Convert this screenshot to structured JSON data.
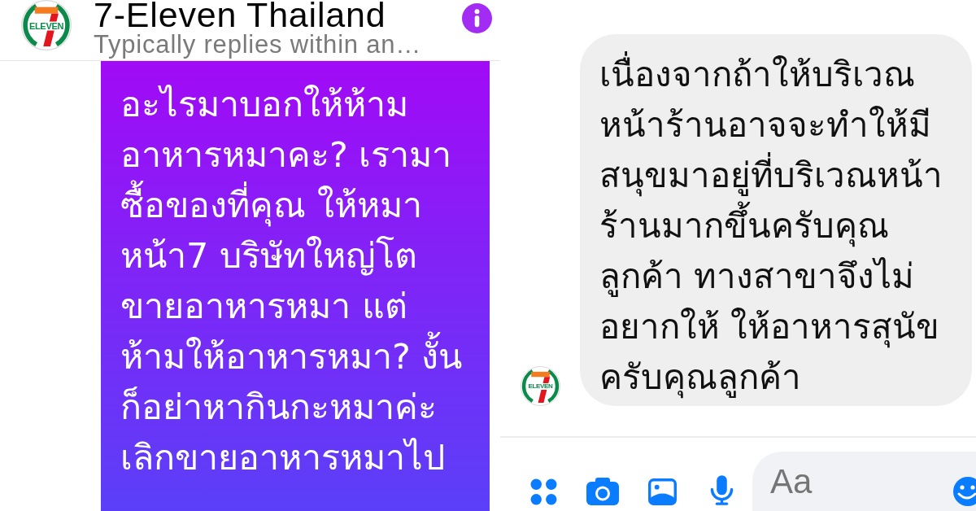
{
  "left_screenshot": {
    "header": {
      "avatar": {
        "logo_text": "ELEVEN"
      },
      "title": "7-Eleven Thailand",
      "subtitle": "Typically replies within an…"
    },
    "message": {
      "kind": "sent",
      "lines": [
        "อะไรมาบอกให้ห้าม",
        "อาหารหมาคะ? เรามา",
        "ซื้อของที่คุณ ให้หมา",
        "หน้า7 บริษัทใหญ่โต",
        "ขายอาหารหมา แต่",
        "ห้ามให้อาหารหมา? งั้น",
        "ก็อย่าหากินกะหมาค่ะ",
        "เลิกขายอาหารหมาไป"
      ]
    }
  },
  "right_screenshot": {
    "message": {
      "kind": "received",
      "avatar": {
        "logo_text": "ELEVEN"
      },
      "lines": [
        "เนื่องจากถ้าให้บริเวณ",
        "หน้าร้านอาจจะทำให้มี",
        "สนุขมาอยู่ที่บริเวณหน้า",
        "ร้านมากขึ้นครับคุณ",
        "ลูกค้า ทางสาขาจึงไม่",
        "อยากให้ ให้อาหารสุนัข",
        "ครับคุณลูกค้า"
      ]
    },
    "composer": {
      "placeholder": "Aa"
    }
  }
}
